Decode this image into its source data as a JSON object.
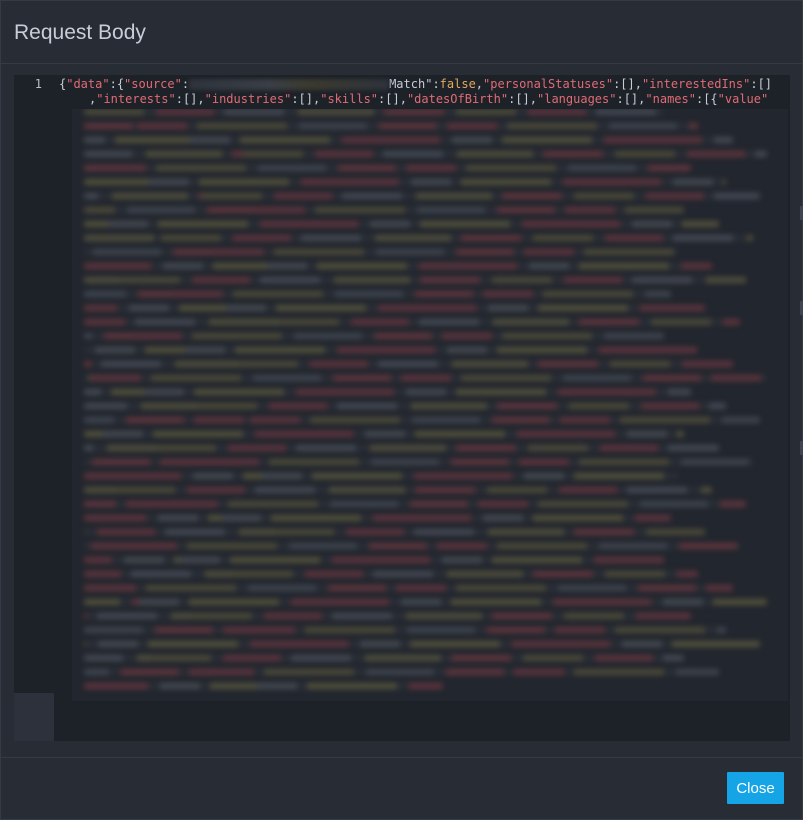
{
  "modal": {
    "title": "Request Body",
    "close_label": "Close"
  },
  "editor": {
    "line_number": "1",
    "line1": {
      "open": "{",
      "k_data": "\"data\"",
      "p1": ":{",
      "k_source": "\"source\"",
      "p2": ":",
      "k_match_tail": "Match\"",
      "p3": ":",
      "v_false": "false",
      "p4": ",",
      "k_personal": "\"personalStatuses\"",
      "p5": ":[],",
      "k_interestedIns": "\"interestedIns\"",
      "p6": ":[]"
    },
    "line2": {
      "p0": ",",
      "k_interests": "\"interests\"",
      "p1": ":[],",
      "k_industries": "\"industries\"",
      "p2": ":[],",
      "k_skills": "\"skills\"",
      "p3": ":[],",
      "k_dob": "\"datesOfBirth\"",
      "p4": ":[],",
      "k_languages": "\"languages\"",
      "p5": ":[],",
      "k_names": "\"names\"",
      "p6": ":[{",
      "k_value": "\"value\""
    }
  },
  "colors": {
    "string_key": "#e06c75",
    "keyword": "#e5a75c",
    "button": "#15a4e6",
    "background": "#272c35"
  }
}
